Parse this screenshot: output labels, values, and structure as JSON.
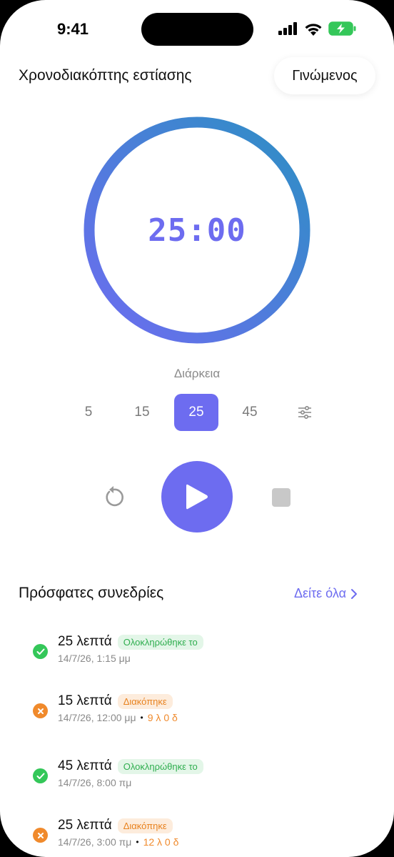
{
  "status_bar": {
    "time": "9:41"
  },
  "header": {
    "title": "Χρονοδιακόπτης εστίασης",
    "mode_button": "Γινώμενος"
  },
  "timer": {
    "display": "25:00",
    "progress": 1.0,
    "ring_colors": [
      "#2d8fc4",
      "#6d6cf0"
    ]
  },
  "duration": {
    "label": "Διάρκεια",
    "presets": [
      "5",
      "15",
      "25",
      "45"
    ],
    "selected": "25",
    "settings_icon": "sliders-icon"
  },
  "controls": {
    "reset_icon": "reset-icon",
    "play_icon": "play-icon",
    "stop_icon": "stop-icon"
  },
  "recent": {
    "title": "Πρόσφατες συνεδρίες",
    "see_all": "Δείτε όλα",
    "sessions": [
      {
        "duration": "25 λεπτά",
        "status": "Ολοκληρώθηκε το",
        "state": "completed",
        "date": "14/7/26, 1:15 μμ",
        "remaining": ""
      },
      {
        "duration": "15 λεπτά",
        "status": "Διακόπηκε",
        "state": "interrupted",
        "date": "14/7/26, 12:00 μμ",
        "remaining": "9 λ 0 δ"
      },
      {
        "duration": "45 λεπτά",
        "status": "Ολοκληρώθηκε το",
        "state": "completed",
        "date": "14/7/26, 8:00 πμ",
        "remaining": ""
      },
      {
        "duration": "25 λεπτά",
        "status": "Διακόπηκε",
        "state": "interrupted",
        "date": "14/7/26, 3:00 πμ",
        "remaining": "12 λ 0 δ"
      }
    ]
  },
  "colors": {
    "accent": "#6d6cf0",
    "success": "#34c759",
    "warning": "#f08a2c"
  }
}
